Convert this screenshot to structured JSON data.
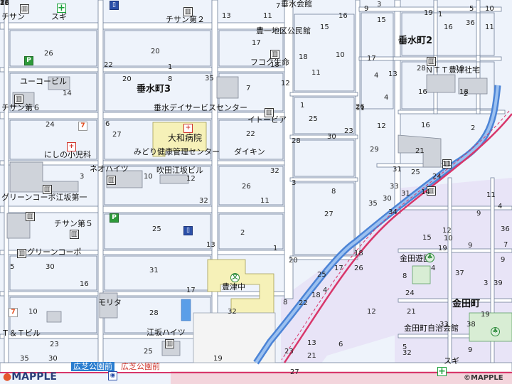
{
  "map": {
    "colors": {
      "block": "#eef3fb",
      "road": "#ffffff",
      "outline": "#6f7f98",
      "railway": "#d8366a",
      "river": "#4c84d6",
      "district_east": "#e8e4f7",
      "building": "#cfd3da",
      "school": "#f6f1b8",
      "park": "#d8edd4"
    },
    "districts": [
      {
        "label": "垂水町3",
        "name": "district-tarumi-3"
      },
      {
        "label": "垂水町2",
        "name": "district-tarumi-2"
      },
      {
        "label": "金田町",
        "name": "district-kaneda"
      }
    ],
    "places": [
      {
        "label": "チサン",
        "name": "label-chisan"
      },
      {
        "label": "スギ",
        "name": "label-sugi-north"
      },
      {
        "label": "チサン第２",
        "name": "label-chisan-2"
      },
      {
        "label": "垂水会館",
        "name": "label-tarumi-kaikan"
      },
      {
        "label": "豊一地区公民館",
        "name": "label-toyoichi-kominkan"
      },
      {
        "label": "フコク生命",
        "name": "label-fukoku-seimei"
      },
      {
        "label": "ＮＴＴ豊津社宅",
        "name": "label-ntt-shataku"
      },
      {
        "label": "ユーコービル",
        "name": "label-yuko-building"
      },
      {
        "label": "チサン第６",
        "name": "label-chisan-6"
      },
      {
        "label": "垂水デイサービスセンター",
        "name": "label-day-service"
      },
      {
        "label": "イトービア",
        "name": "label-itopia"
      },
      {
        "label": "大和病院",
        "name": "label-yamato-hospital"
      },
      {
        "label": "みどり健康管理センター",
        "name": "label-midori-center"
      },
      {
        "label": "ダイキン",
        "name": "label-daikin"
      },
      {
        "label": "にしの小児科",
        "name": "label-nishino-clinic"
      },
      {
        "label": "ネオハイツ",
        "name": "label-neo-heights"
      },
      {
        "label": "吹田江坂ビル",
        "name": "label-suita-esaka-building"
      },
      {
        "label": "グリーンコーポ江坂第一",
        "name": "label-green-corpo-1"
      },
      {
        "label": "チサン第５",
        "name": "label-chisan-5"
      },
      {
        "label": "グリーンコーポ",
        "name": "label-green-corpo"
      },
      {
        "label": "金田遊園",
        "name": "label-kaneda-park"
      },
      {
        "label": "豊津中",
        "name": "label-toyotsu-junior-high"
      },
      {
        "label": "モリタ",
        "name": "label-morita"
      },
      {
        "label": "Ｔ＆Ｔビル",
        "name": "label-tt-building"
      },
      {
        "label": "金田町自治会館",
        "name": "label-kaneda-jichikaikan"
      },
      {
        "label": "江坂ハイツ",
        "name": "label-esaka-heights"
      },
      {
        "label": "スギ",
        "name": "label-sugi-south"
      }
    ],
    "stations": [
      {
        "label": "広芝公園前",
        "name": "station-hiroshiba-blue"
      },
      {
        "label": "広芝公園前",
        "name": "station-hiroshiba-red"
      }
    ],
    "numbers": [
      "13",
      "11",
      "7",
      "16",
      "9",
      "15",
      "3",
      "19",
      "1",
      "5",
      "36",
      "10",
      "15",
      "17",
      "16",
      "11",
      "26",
      "20",
      "1",
      "18",
      "10",
      "17",
      "13",
      "28",
      "19",
      "11",
      "18",
      "22",
      "20",
      "8",
      "35",
      "14",
      "7",
      "4",
      "16",
      "18",
      "12",
      "1",
      "11",
      "4",
      "2",
      "12",
      "16",
      "2",
      "24",
      "6",
      "26",
      "25",
      "23",
      "22",
      "27",
      "28",
      "30",
      "29",
      "21",
      "11",
      "31",
      "25",
      "24",
      "3",
      "10",
      "32",
      "12",
      "26",
      "11",
      "3",
      "8",
      "33",
      "31",
      "30",
      "14",
      "34",
      "11",
      "4",
      "35",
      "32",
      "9",
      "12",
      "15",
      "25",
      "2",
      "27",
      "36",
      "10",
      "9",
      "19",
      "7",
      "9",
      "13",
      "1",
      "5",
      "30",
      "31",
      "16",
      "18",
      "8",
      "20",
      "25",
      "17",
      "4",
      "37",
      "3",
      "39",
      "26",
      "24",
      "4",
      "17",
      "18",
      "8",
      "22",
      "12",
      "21",
      "33",
      "38",
      "23",
      "28",
      "10",
      "19",
      "32",
      "5",
      "13",
      "9",
      "21",
      "6",
      "23",
      "32",
      "27",
      "35",
      "30",
      "25",
      "19",
      "26",
      "36",
      "28",
      "8",
      "11",
      "7"
    ],
    "branding": {
      "left_logo": "MAPPLE",
      "right_logo": "©MAPPLE"
    }
  }
}
